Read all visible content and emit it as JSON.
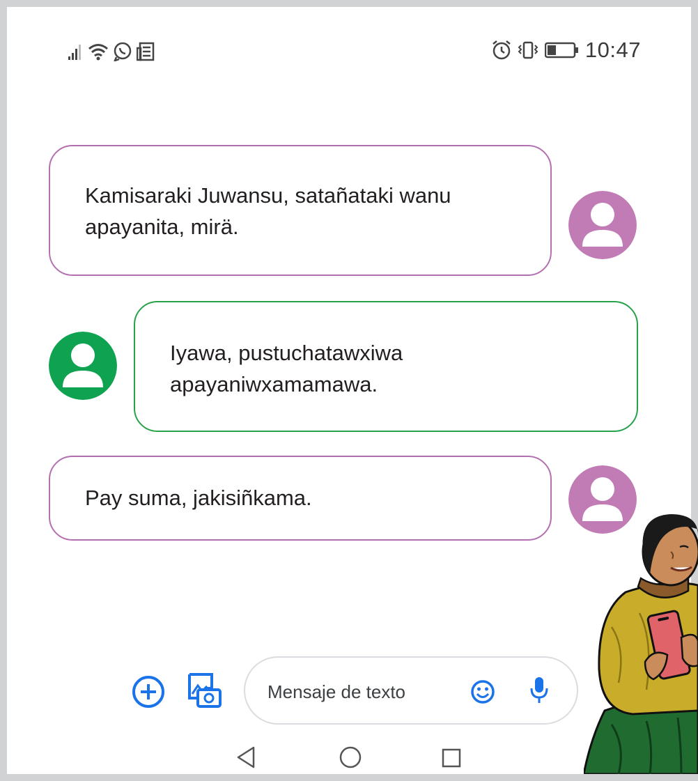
{
  "status_bar": {
    "left_icons": [
      "signal-icon",
      "wifi-icon",
      "whatsapp-icon",
      "news-icon"
    ],
    "right_icons": [
      "alarm-icon",
      "vibrate-icon",
      "battery-icon"
    ],
    "time": "10:47"
  },
  "messages": [
    {
      "sender": "other",
      "color": "#b46fb0",
      "lines": [
        "Kamisaraki Juwansu, satañataki wanu",
        "apayanita, mirä."
      ]
    },
    {
      "sender": "self",
      "color": "#27a24a",
      "lines": [
        "Iyawa, pustuchatawxiwa",
        "apayaniwxamamawa."
      ]
    },
    {
      "sender": "other",
      "color": "#b46fb0",
      "lines": [
        "Pay suma, jakisiñkama."
      ]
    }
  ],
  "composer": {
    "placeholder": "Mensaje de texto",
    "buttons": [
      "add-circle-icon",
      "gallery-icon",
      "emoji-icon",
      "microphone-icon"
    ],
    "accent": "#1a73e8"
  },
  "nav_bar": {
    "buttons": [
      "back-icon",
      "home-icon",
      "recents-icon"
    ]
  }
}
